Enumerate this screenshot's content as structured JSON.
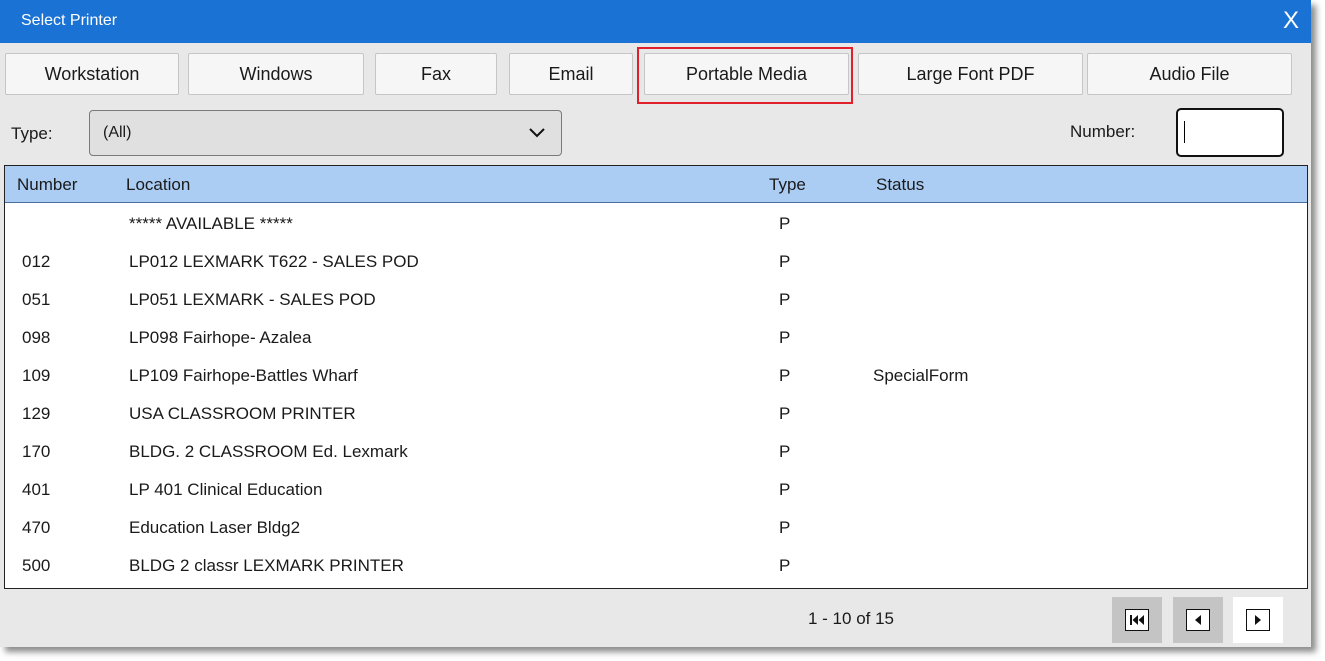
{
  "dialog": {
    "title": "Select Printer",
    "close_label": "X"
  },
  "tabs": [
    {
      "label": "Workstation"
    },
    {
      "label": "Windows"
    },
    {
      "label": "Fax"
    },
    {
      "label": "Email"
    },
    {
      "label": "Portable Media",
      "highlighted": true
    },
    {
      "label": "Large Font PDF"
    },
    {
      "label": "Audio File"
    }
  ],
  "filter": {
    "type_label": "Type:",
    "type_value": "(All)",
    "number_label": "Number:",
    "number_value": ""
  },
  "table": {
    "columns": [
      "Number",
      "Location",
      "Type",
      "Status"
    ],
    "rows": [
      {
        "number": "",
        "location": "***** AVAILABLE *****",
        "type": "P",
        "status": ""
      },
      {
        "number": "012",
        "location": "LP012 LEXMARK T622 - SALES POD",
        "type": "P",
        "status": ""
      },
      {
        "number": "051",
        "location": "LP051 LEXMARK - SALES POD",
        "type": "P",
        "status": ""
      },
      {
        "number": "098",
        "location": "LP098 Fairhope- Azalea",
        "type": "P",
        "status": ""
      },
      {
        "number": "109",
        "location": "LP109 Fairhope-Battles Wharf",
        "type": "P",
        "status": "SpecialForm"
      },
      {
        "number": "129",
        "location": "USA CLASSROOM PRINTER",
        "type": "P",
        "status": ""
      },
      {
        "number": "170",
        "location": "BLDG. 2 CLASSROOM Ed. Lexmark",
        "type": "P",
        "status": ""
      },
      {
        "number": "401",
        "location": "LP 401 Clinical Education",
        "type": "P",
        "status": ""
      },
      {
        "number": "470",
        "location": "Education Laser Bldg2",
        "type": "P",
        "status": ""
      },
      {
        "number": "500",
        "location": "BLDG 2 classr LEXMARK PRINTER",
        "type": "P",
        "status": ""
      }
    ]
  },
  "pager": {
    "range_text": "1 - 10 of 15"
  },
  "colors": {
    "titlebar": "#1a73d4",
    "header_row": "#abcdf4",
    "highlight": "#e0202a"
  }
}
